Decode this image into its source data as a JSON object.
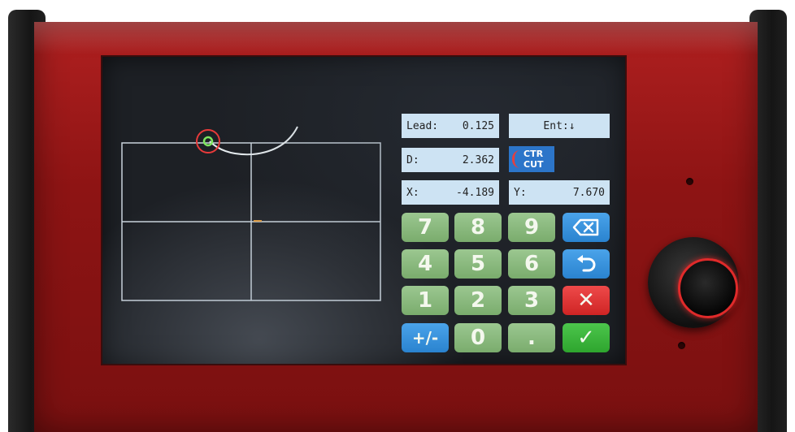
{
  "fields": {
    "lead": {
      "label": "Lead:",
      "value": "0.125"
    },
    "entry": {
      "label": "Ent:↓"
    },
    "d": {
      "label": "D:",
      "value": "2.362"
    },
    "x": {
      "label": "X:",
      "value": "-4.189"
    },
    "y": {
      "label": "Y:",
      "value": "7.670"
    }
  },
  "mode_button": {
    "line1": "CTR",
    "line2": "CUT",
    "icon": "arc-icon"
  },
  "keypad": {
    "k7": "7",
    "k8": "8",
    "k9": "9",
    "k4": "4",
    "k5": "5",
    "k6": "6",
    "k1": "1",
    "k2": "2",
    "k3": "3",
    "sign": "+/-",
    "k0": "0",
    "dot": ".",
    "backspace_icon": "backspace-icon",
    "undo_icon": "undo-icon",
    "cancel": "✕",
    "confirm": "✓"
  },
  "colors": {
    "bezel": "#8e1414",
    "key_num": "#7aac6d",
    "key_blue": "#2a83cf",
    "key_red": "#cf2424",
    "key_green": "#2ea52e",
    "field_bg": "#cde3f3"
  }
}
